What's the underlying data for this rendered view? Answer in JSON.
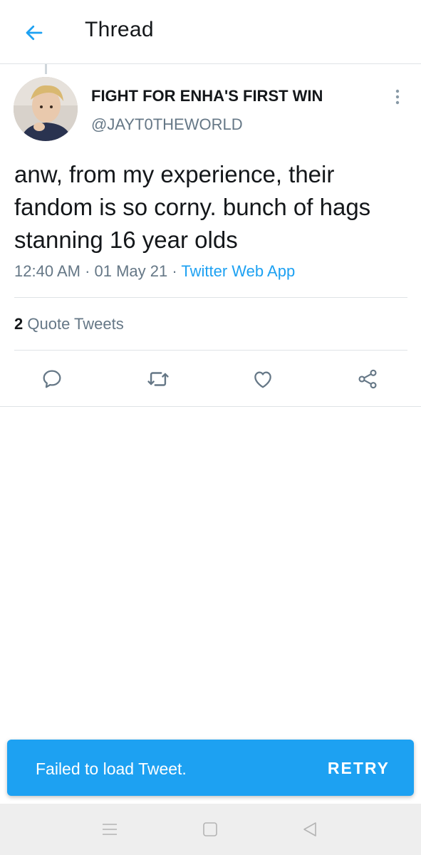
{
  "header": {
    "title": "Thread",
    "back_icon": "arrow-left-icon"
  },
  "tweet": {
    "display_name": "FIGHT FOR ENHA'S FIRST WIN",
    "handle": "@JAYT0THEWORLD",
    "text": "anw, from my experience, their fandom is so corny. bunch of hags stanning 16 year olds",
    "time": "12:40 AM",
    "separator": " · ",
    "date": "01 May 21",
    "source": "Twitter Web App",
    "quote_count": "2",
    "quote_label": "Quote Tweets"
  },
  "actions": [
    "reply-icon",
    "retweet-icon",
    "like-icon",
    "share-icon"
  ],
  "toast": {
    "message": "Failed to load Tweet.",
    "action_label": "RETRY"
  },
  "colors": {
    "accent": "#1da1f2",
    "text_primary": "#14171a",
    "text_secondary": "#657786",
    "divider": "#dfe3e6"
  }
}
